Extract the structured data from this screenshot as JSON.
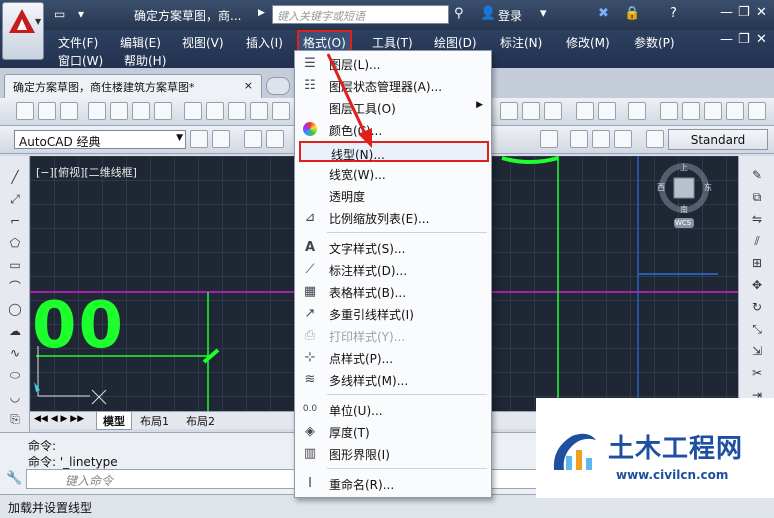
{
  "titlebar": {
    "doc_title": "确定方案草图，商...",
    "search_placeholder": "键入关键字或短语",
    "login": "登录",
    "help": "?"
  },
  "menubar": {
    "items": [
      "文件(F)",
      "编辑(E)",
      "视图(V)",
      "插入(I)",
      "格式(O)",
      "工具(T)",
      "绘图(D)",
      "标注(N)",
      "修改(M)",
      "参数(P)"
    ],
    "items_row2": [
      "窗口(W)",
      "帮助(H)"
    ]
  },
  "tabs": {
    "doc_tab": "确定方案草图，商住楼建筑方案草图*",
    "close": "×"
  },
  "toolbar": {
    "workspace": "AutoCAD 经典",
    "text_style": "Standard"
  },
  "canvas": {
    "view_label": "[−][俯视][二维线框]",
    "big_text": "00"
  },
  "layout_tabs": [
    "模型",
    "布局1",
    "布局2"
  ],
  "command": {
    "line1": "命令:",
    "line2": "命令: '_linetype",
    "input_placeholder": "键入命令"
  },
  "status": {
    "text": "加载并设置线型"
  },
  "format_menu": {
    "items": [
      {
        "label": "图层(L)...",
        "icon": "layer-icon"
      },
      {
        "label": "图层状态管理器(A)...",
        "icon": "layer-state-icon"
      },
      {
        "label": "图层工具(O)",
        "icon": "",
        "submenu": "▶"
      },
      {
        "label": "颜色(C)...",
        "icon": "color-wheel-icon"
      },
      {
        "label": "线型(N)...",
        "icon": ""
      },
      {
        "label": "线宽(W)...",
        "icon": ""
      },
      {
        "label": "透明度",
        "icon": ""
      },
      {
        "label": "比例缩放列表(E)...",
        "icon": "scale-list-icon"
      },
      {
        "label": "文字样式(S)...",
        "icon": "text-style-icon"
      },
      {
        "label": "标注样式(D)...",
        "icon": "dim-style-icon"
      },
      {
        "label": "表格样式(B)...",
        "icon": "table-style-icon"
      },
      {
        "label": "多重引线样式(I)",
        "icon": "mleader-style-icon"
      },
      {
        "label": "打印样式(Y)...",
        "icon": "plot-style-icon"
      },
      {
        "label": "点样式(P)...",
        "icon": "point-style-icon"
      },
      {
        "label": "多线样式(M)...",
        "icon": "mline-style-icon"
      },
      {
        "label": "单位(U)...",
        "icon": "units-icon"
      },
      {
        "label": "厚度(T)",
        "icon": "thickness-icon"
      },
      {
        "label": "图形界限(I)",
        "icon": "limits-icon"
      },
      {
        "label": "重命名(R)...",
        "icon": "rename-icon"
      }
    ]
  },
  "viewcube": {
    "north": "北",
    "south": "南",
    "east": "东",
    "west": "西",
    "top": "上",
    "wcs": "WCS"
  },
  "watermark": {
    "title": "土木工程网",
    "url": "www.civilcn.com"
  },
  "colors": {
    "highlight_red": "#e0201c",
    "canvas_bg": "#1f2735",
    "drawing_green": "#1dff2c"
  }
}
